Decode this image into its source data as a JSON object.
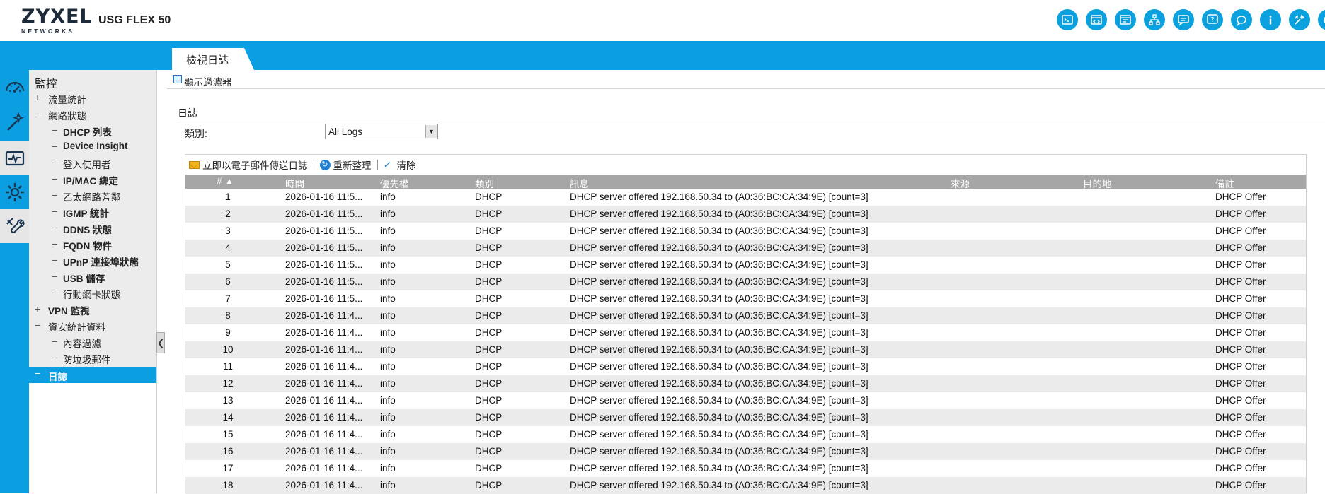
{
  "header": {
    "logo_main": "ZYXEL",
    "logo_sub": "NETWORKS",
    "model": "USG FLEX 50",
    "icons": [
      "console-icon",
      "cli-icon",
      "window-icon",
      "sitemap-icon",
      "messages-icon",
      "help-icon",
      "chat-icon",
      "info-icon",
      "tools-icon",
      "logout-icon"
    ]
  },
  "tab": {
    "label": "檢視日誌"
  },
  "rail": {
    "items": [
      "dashboard-icon",
      "wizard-icon",
      "monitor-icon",
      "configuration-icon",
      "maintenance-icon"
    ]
  },
  "tree": {
    "title": "監控",
    "items": [
      {
        "label": "流量統計",
        "marker": "+"
      },
      {
        "label": "網路狀態",
        "marker": "−"
      },
      {
        "label": "DHCP 列表",
        "marker": "−"
      },
      {
        "label": "Device Insight",
        "marker": "−"
      },
      {
        "label": "登入使用者",
        "marker": "−"
      },
      {
        "label": "IP/MAC 綁定",
        "marker": "−"
      },
      {
        "label": "乙太網路芳鄰",
        "marker": "−"
      },
      {
        "label": "IGMP 統計",
        "marker": "−"
      },
      {
        "label": "DDNS 狀態",
        "marker": "−"
      },
      {
        "label": "FQDN 物件",
        "marker": "−"
      },
      {
        "label": "UPnP 連接埠狀態",
        "marker": "−"
      },
      {
        "label": "USB 儲存",
        "marker": "−"
      },
      {
        "label": "行動網卡狀態",
        "marker": "−"
      },
      {
        "label": "VPN 監視",
        "marker": "+"
      },
      {
        "label": "資安統計資料",
        "marker": "−"
      },
      {
        "label": "內容過濾",
        "marker": "−"
      },
      {
        "label": "防垃圾郵件",
        "marker": "−"
      },
      {
        "label": "日誌",
        "marker": "−"
      }
    ]
  },
  "filter": {
    "label": "顯示過濾器"
  },
  "section": {
    "label": "日誌"
  },
  "category": {
    "label": "類別:",
    "value": "All Logs"
  },
  "toolbar": {
    "email": "立即以電子郵件傳送日誌",
    "refresh": "重新整理",
    "clear": "清除"
  },
  "table": {
    "columns": [
      "# ▲",
      "時間",
      "優先權",
      "類別",
      "訊息",
      "來源",
      "目的地",
      "備註"
    ],
    "rows": [
      [
        "1",
        "2026-01-16 11:5...",
        "info",
        "DHCP",
        "DHCP server offered 192.168.50.34 to (A0:36:BC:CA:34:9E) [count=3]",
        "",
        "",
        "DHCP Offer"
      ],
      [
        "2",
        "2026-01-16 11:5...",
        "info",
        "DHCP",
        "DHCP server offered 192.168.50.34 to (A0:36:BC:CA:34:9E) [count=3]",
        "",
        "",
        "DHCP Offer"
      ],
      [
        "3",
        "2026-01-16 11:5...",
        "info",
        "DHCP",
        "DHCP server offered 192.168.50.34 to (A0:36:BC:CA:34:9E) [count=3]",
        "",
        "",
        "DHCP Offer"
      ],
      [
        "4",
        "2026-01-16 11:5...",
        "info",
        "DHCP",
        "DHCP server offered 192.168.50.34 to (A0:36:BC:CA:34:9E) [count=3]",
        "",
        "",
        "DHCP Offer"
      ],
      [
        "5",
        "2026-01-16 11:5...",
        "info",
        "DHCP",
        "DHCP server offered 192.168.50.34 to (A0:36:BC:CA:34:9E) [count=3]",
        "",
        "",
        "DHCP Offer"
      ],
      [
        "6",
        "2026-01-16 11:5...",
        "info",
        "DHCP",
        "DHCP server offered 192.168.50.34 to (A0:36:BC:CA:34:9E) [count=3]",
        "",
        "",
        "DHCP Offer"
      ],
      [
        "7",
        "2026-01-16 11:5...",
        "info",
        "DHCP",
        "DHCP server offered 192.168.50.34 to (A0:36:BC:CA:34:9E) [count=3]",
        "",
        "",
        "DHCP Offer"
      ],
      [
        "8",
        "2026-01-16 11:4...",
        "info",
        "DHCP",
        "DHCP server offered 192.168.50.34 to (A0:36:BC:CA:34:9E) [count=3]",
        "",
        "",
        "DHCP Offer"
      ],
      [
        "9",
        "2026-01-16 11:4...",
        "info",
        "DHCP",
        "DHCP server offered 192.168.50.34 to (A0:36:BC:CA:34:9E) [count=3]",
        "",
        "",
        "DHCP Offer"
      ],
      [
        "10",
        "2026-01-16 11:4...",
        "info",
        "DHCP",
        "DHCP server offered 192.168.50.34 to (A0:36:BC:CA:34:9E) [count=3]",
        "",
        "",
        "DHCP Offer"
      ],
      [
        "11",
        "2026-01-16 11:4...",
        "info",
        "DHCP",
        "DHCP server offered 192.168.50.34 to (A0:36:BC:CA:34:9E) [count=3]",
        "",
        "",
        "DHCP Offer"
      ],
      [
        "12",
        "2026-01-16 11:4...",
        "info",
        "DHCP",
        "DHCP server offered 192.168.50.34 to (A0:36:BC:CA:34:9E) [count=3]",
        "",
        "",
        "DHCP Offer"
      ],
      [
        "13",
        "2026-01-16 11:4...",
        "info",
        "DHCP",
        "DHCP server offered 192.168.50.34 to (A0:36:BC:CA:34:9E) [count=3]",
        "",
        "",
        "DHCP Offer"
      ],
      [
        "14",
        "2026-01-16 11:4...",
        "info",
        "DHCP",
        "DHCP server offered 192.168.50.34 to (A0:36:BC:CA:34:9E) [count=3]",
        "",
        "",
        "DHCP Offer"
      ],
      [
        "15",
        "2026-01-16 11:4...",
        "info",
        "DHCP",
        "DHCP server offered 192.168.50.34 to (A0:36:BC:CA:34:9E) [count=3]",
        "",
        "",
        "DHCP Offer"
      ],
      [
        "16",
        "2026-01-16 11:4...",
        "info",
        "DHCP",
        "DHCP server offered 192.168.50.34 to (A0:36:BC:CA:34:9E) [count=3]",
        "",
        "",
        "DHCP Offer"
      ],
      [
        "17",
        "2026-01-16 11:4...",
        "info",
        "DHCP",
        "DHCP server offered 192.168.50.34 to (A0:36:BC:CA:34:9E) [count=3]",
        "",
        "",
        "DHCP Offer"
      ],
      [
        "18",
        "2026-01-16 11:4...",
        "info",
        "DHCP",
        "DHCP server offered 192.168.50.34 to (A0:36:BC:CA:34:9E) [count=3]",
        "",
        "",
        "DHCP Offer"
      ]
    ]
  },
  "colors": {
    "brand_blue": "#0b9ee0",
    "header_row": "#a6a6a6",
    "stripe": "#ebebeb"
  }
}
